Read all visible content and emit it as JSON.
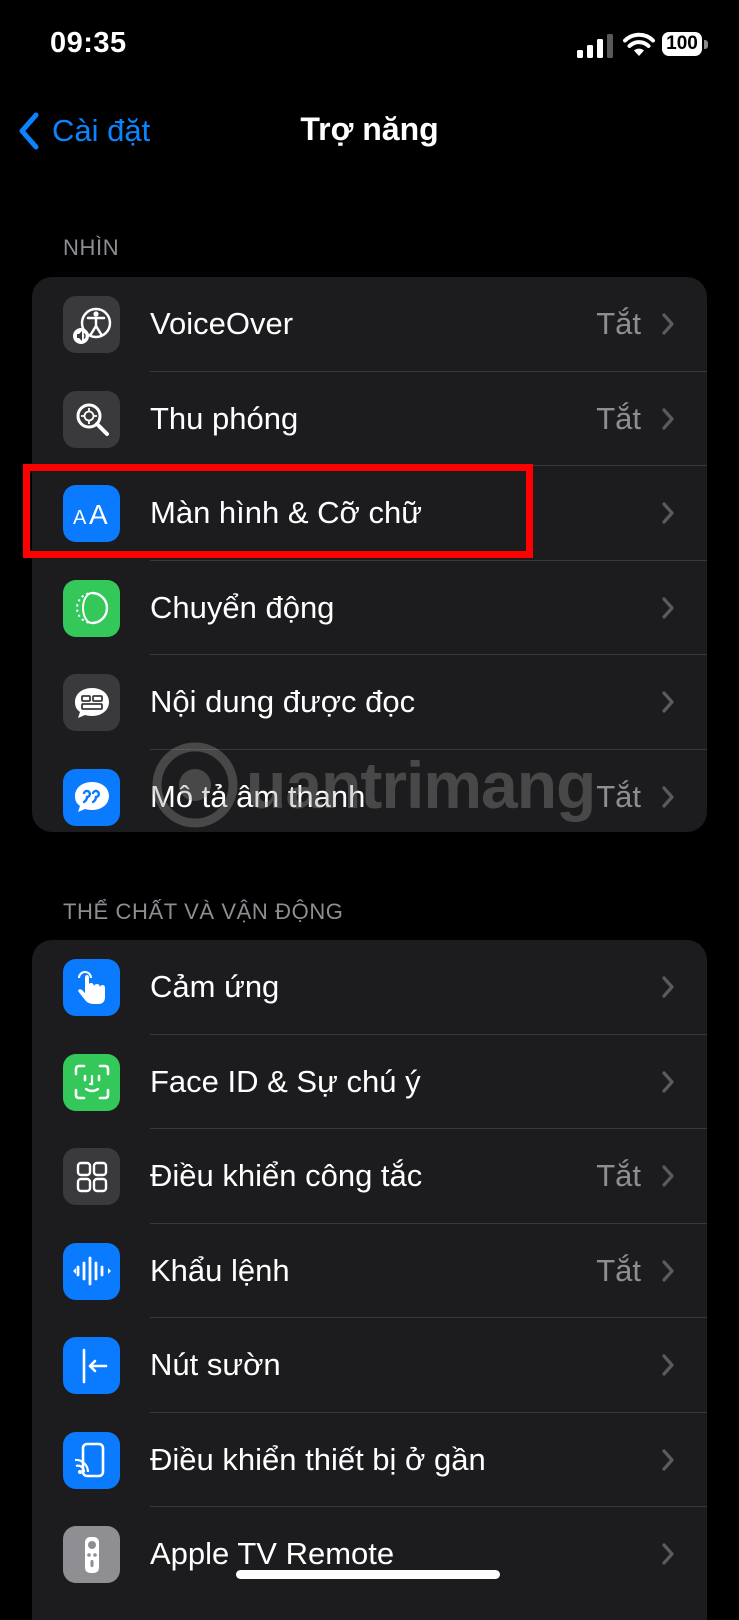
{
  "status_bar": {
    "time": "09:35",
    "battery_level": "100"
  },
  "nav": {
    "back_label": "Cài đặt",
    "title": "Trợ năng"
  },
  "sections": [
    {
      "header": "NHÌN",
      "items": [
        {
          "label": "VoiceOver",
          "value": "Tắt",
          "icon": "voiceover-icon",
          "icon_color": "#3a3a3c"
        },
        {
          "label": "Thu phóng",
          "value": "Tắt",
          "icon": "zoom-icon",
          "icon_color": "#3a3a3c"
        },
        {
          "label": "Màn hình & Cỡ chữ",
          "value": "",
          "icon": "text-size-icon",
          "icon_color": "#0a7aff"
        },
        {
          "label": "Chuyển động",
          "value": "",
          "icon": "motion-icon",
          "icon_color": "#34c759"
        },
        {
          "label": "Nội dung được đọc",
          "value": "",
          "icon": "spoken-content-icon",
          "icon_color": "#3a3a3c"
        },
        {
          "label": "Mô tả âm thanh",
          "value": "Tắt",
          "icon": "audio-description-icon",
          "icon_color": "#0a7aff"
        }
      ]
    },
    {
      "header": "THỂ CHẤT VÀ VẬN ĐỘNG",
      "items": [
        {
          "label": "Cảm ứng",
          "value": "",
          "icon": "touch-icon",
          "icon_color": "#0a7aff"
        },
        {
          "label": "Face ID & Sự chú ý",
          "value": "",
          "icon": "face-id-icon",
          "icon_color": "#34c759"
        },
        {
          "label": "Điều khiển công tắc",
          "value": "Tắt",
          "icon": "switch-control-icon",
          "icon_color": "#3a3a3c"
        },
        {
          "label": "Khẩu lệnh",
          "value": "Tắt",
          "icon": "voice-control-icon",
          "icon_color": "#0a7aff"
        },
        {
          "label": "Nút sườn",
          "value": "",
          "icon": "side-button-icon",
          "icon_color": "#0a7aff"
        },
        {
          "label": "Điều khiển thiết bị ở gần",
          "value": "",
          "icon": "nearby-device-icon",
          "icon_color": "#0a7aff"
        },
        {
          "label": "Apple TV Remote",
          "value": "",
          "icon": "tv-remote-icon",
          "icon_color": "#8e8e93"
        }
      ]
    }
  ],
  "watermark": {
    "text": "uantrimang"
  },
  "colors": {
    "accent": "#0a84ff",
    "highlight": "#ff0000",
    "background": "#000000",
    "cell": "#1c1c1e",
    "secondary_text": "#8d8d93"
  }
}
